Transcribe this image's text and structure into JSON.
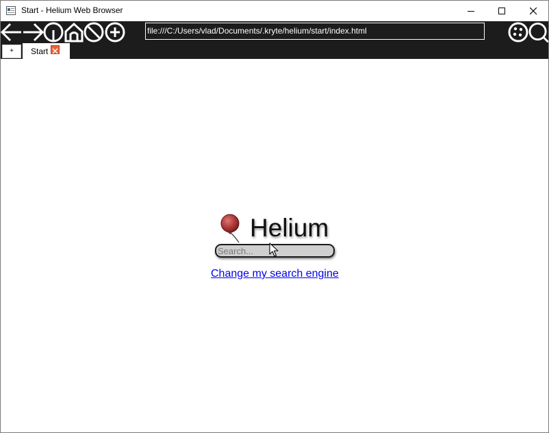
{
  "window": {
    "title": "Start - Helium Web Browser"
  },
  "toolbar": {
    "address": "file:///C:/Users/vlad/Documents/.kryte/helium/start/index.html",
    "buttons": [
      "back-icon",
      "forward-icon",
      "info-icon",
      "home-icon",
      "reload-icon",
      "new-tab-icon",
      "extensions-icon",
      "search-icon"
    ]
  },
  "tabs": {
    "add_label": "+",
    "items": [
      {
        "label": "Start",
        "active": true
      }
    ]
  },
  "page": {
    "brand": "Helium",
    "search_placeholder": "Search...",
    "change_engine_link": "Change my search engine"
  },
  "colors": {
    "toolbar_bg": "#1c1c1c",
    "logo_red": "#b03a3a",
    "link_blue": "#0000ee",
    "tab_close": "#e8643d"
  }
}
